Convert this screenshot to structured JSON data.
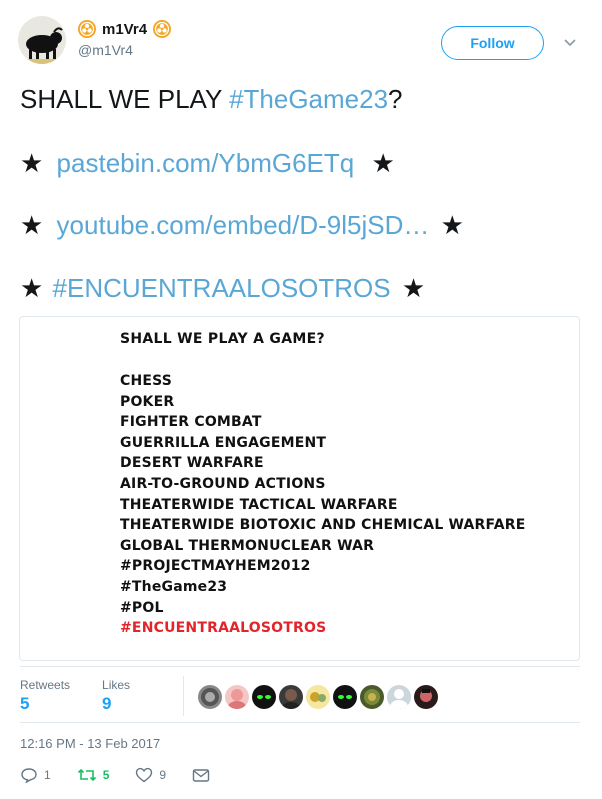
{
  "user": {
    "display_name": "m1Vr4",
    "handle": "@m1Vr4",
    "badge_icon": "biohazard-icon"
  },
  "follow_label": "Follow",
  "tweet": {
    "line1_text": "SHALL WE PLAY ",
    "line1_hashtag": "#TheGame23",
    "line1_suffix": "?",
    "line2_link": "pastebin.com/YbmG6ETq",
    "line3_link": "youtube.com/embed/D-9l5jSD…",
    "line4_hashtag": "#ENCUENTRAALOSOTROS",
    "star": "★"
  },
  "media": {
    "title": "SHALL WE PLAY A GAME?",
    "items": [
      "CHESS",
      "POKER",
      "FIGHTER COMBAT",
      "GUERRILLA ENGAGEMENT",
      "DESERT WARFARE",
      "AIR-TO-GROUND ACTIONS",
      "THEATERWIDE TACTICAL WARFARE",
      "THEATERWIDE BIOTOXIC AND CHEMICAL WARFARE",
      "GLOBAL THERMONUCLEAR WAR",
      "#PROJECTMAYHEM2012",
      "#TheGame23",
      "#POL"
    ],
    "highlight_item": "#ENCUENTRAALOSOTROS"
  },
  "stats": {
    "retweets_label": "Retweets",
    "retweets_value": "5",
    "likes_label": "Likes",
    "likes_value": "9"
  },
  "timestamp": "12:16 PM - 13 Feb 2017",
  "actions": {
    "reply_count": "1",
    "retweet_count": "5",
    "like_count": "9"
  },
  "colors": {
    "link": "#5aa7d6",
    "follow": "#1da1f2",
    "retweet_green": "#17bf63",
    "highlight_red": "#e3242b",
    "badge_orange": "#f5a623"
  }
}
